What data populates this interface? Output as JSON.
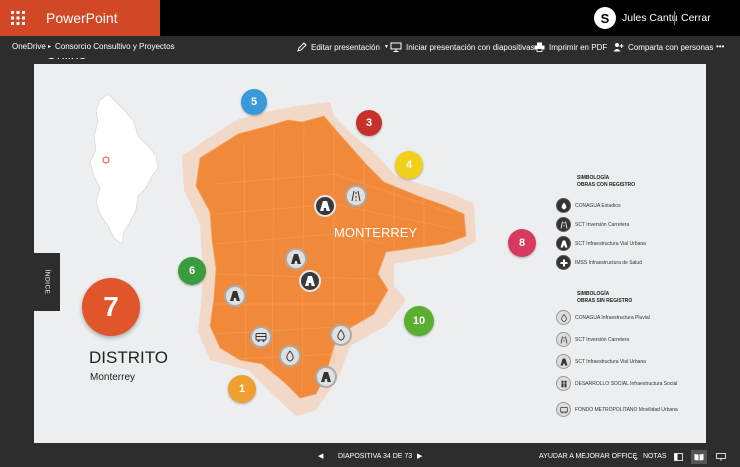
{
  "titlebar": {
    "app_name": "PowerPoint Online",
    "user_name": "Jules Cantú",
    "sign_out": "Cerrar sesión"
  },
  "breadcrumb": {
    "root": "OneDrive",
    "document": "Consorcio Consultivo y Proyectos"
  },
  "commands": {
    "edit": "Editar presentación",
    "slideshow": "Iniciar presentación con diapositivas",
    "print": "Imprimir en PDF",
    "share": "Comparta con personas",
    "more": "•••"
  },
  "slide": {
    "index_tab": "ÍNDICE",
    "district_number": "7",
    "district_label": "DISTRITO",
    "district_name": "Monterrey",
    "map_label": "MONTERREY",
    "district_badges": [
      "5",
      "3",
      "4",
      "6",
      "8",
      "10",
      "1"
    ],
    "legend_with": {
      "title_1": "SIMBOLOGÍA",
      "title_2": "OBRAS CON REGISTRO",
      "items": [
        "CONAGUA Estudios",
        "SCT Inversión Carretera",
        "SCT Infraestructura Vial Urbana",
        "IMSS Infraestructura de Salud"
      ]
    },
    "legend_without": {
      "title_1": "SIMBOLOGÍA",
      "title_2": "OBRAS SIN REGISTRO",
      "items": [
        "CONAGUA Infraestructura Pluvial",
        "SCT Inversión Carretera",
        "SCT Infraestructura Vial Urbana",
        "DESARROLLO SOCIAL Infraestructura Social",
        "FONDO METROPOLITANO Movilidad Urbana"
      ]
    },
    "colors": {
      "map_orange": "#f08a3a",
      "district_7": "#e0552a",
      "badge_5": "#3a9ad9",
      "badge_3": "#c8302c",
      "badge_4": "#f2d01a",
      "badge_6": "#3b9b3f",
      "badge_8": "#d83a5e",
      "badge_10": "#5aae32",
      "badge_1": "#f0a030"
    }
  },
  "statusbar": {
    "slide_counter": "DIAPOSITIVA 34 DE 73",
    "help": "AYUDAR A MEJORAR OFFICE",
    "notes": "NOTAS"
  }
}
